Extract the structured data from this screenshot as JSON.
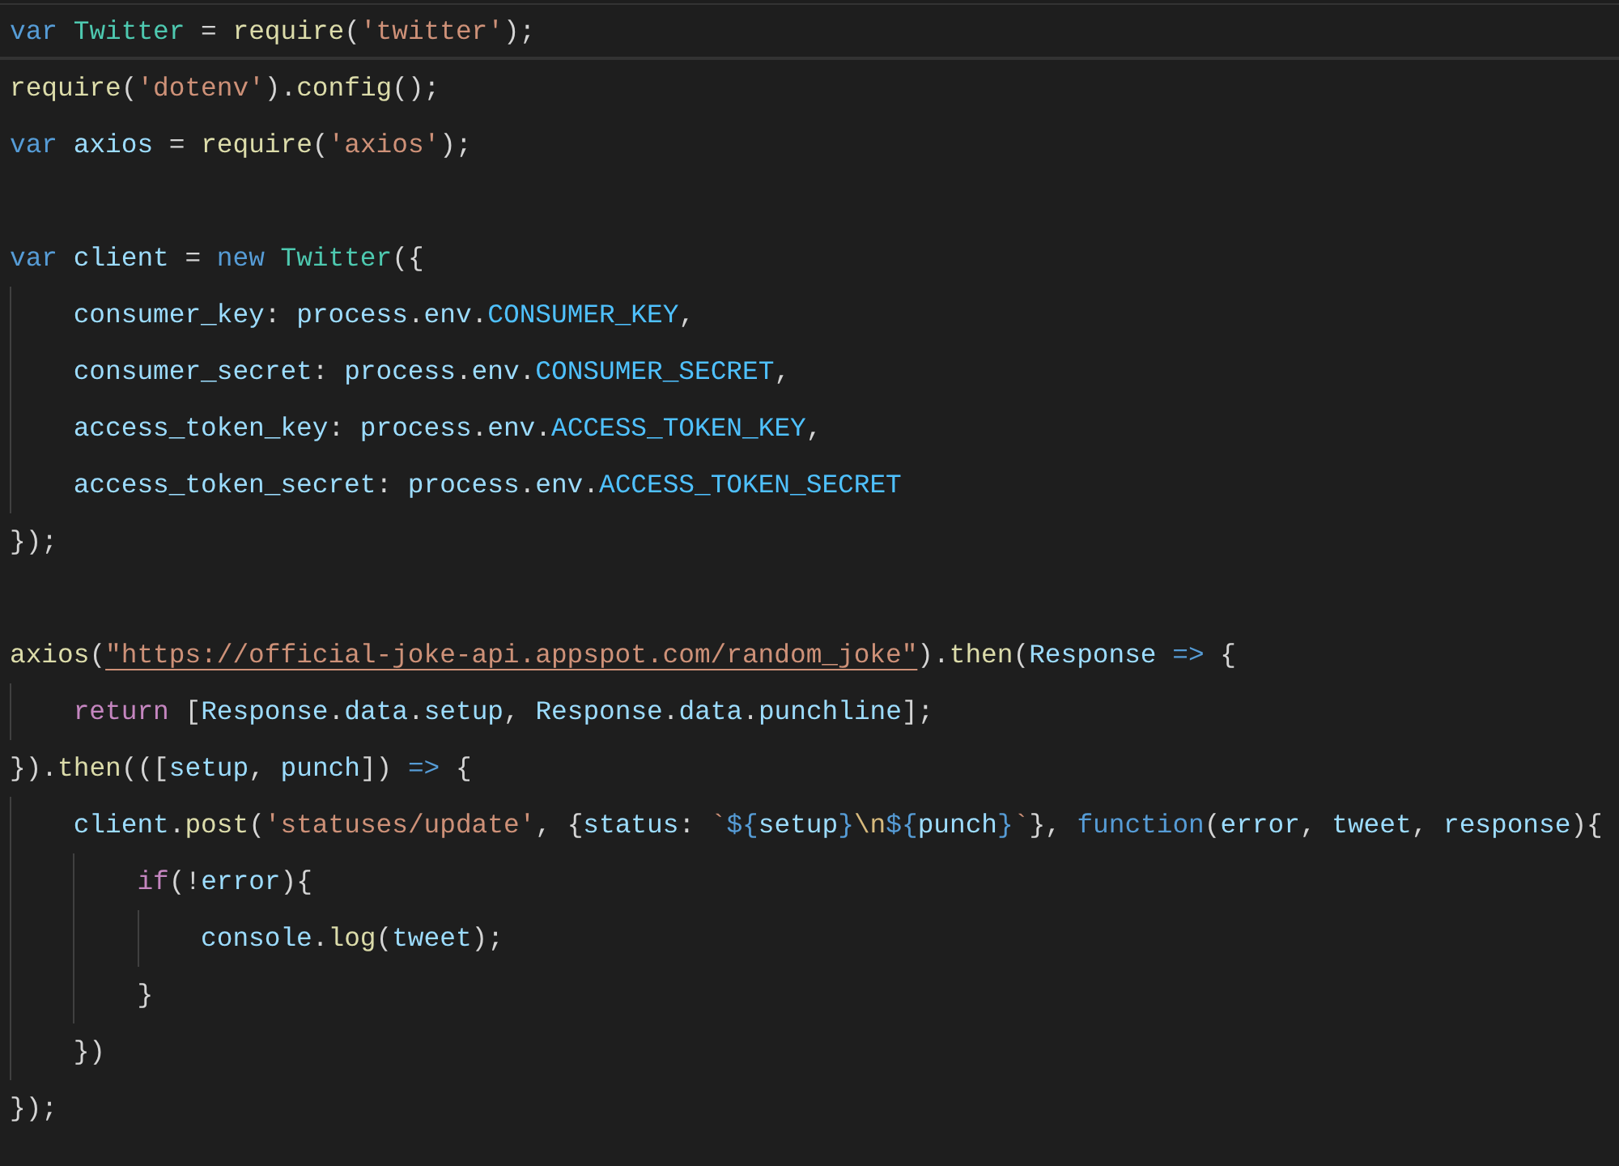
{
  "editor": {
    "lines": [
      {
        "kind": "code",
        "current": true,
        "tokens": [
          {
            "text": "var",
            "kind": "keyword"
          },
          {
            "text": " Twitter",
            "kind": "class"
          },
          {
            "text": " = ",
            "kind": "plain"
          },
          {
            "text": "require",
            "kind": "func"
          },
          {
            "text": "(",
            "kind": "plain"
          },
          {
            "text": "'twitter'",
            "kind": "string"
          },
          {
            "text": ");",
            "kind": "plain"
          }
        ]
      },
      {
        "kind": "code",
        "current": false,
        "tokens": [
          {
            "text": "require",
            "kind": "func"
          },
          {
            "text": "(",
            "kind": "plain"
          },
          {
            "text": "'dotenv'",
            "kind": "string"
          },
          {
            "text": ").",
            "kind": "plain"
          },
          {
            "text": "config",
            "kind": "func"
          },
          {
            "text": "();",
            "kind": "plain"
          }
        ]
      },
      {
        "kind": "code",
        "current": false,
        "tokens": [
          {
            "text": "var",
            "kind": "keyword"
          },
          {
            "text": " axios",
            "kind": "var"
          },
          {
            "text": " = ",
            "kind": "plain"
          },
          {
            "text": "require",
            "kind": "func"
          },
          {
            "text": "(",
            "kind": "plain"
          },
          {
            "text": "'axios'",
            "kind": "string"
          },
          {
            "text": ");",
            "kind": "plain"
          }
        ]
      },
      {
        "kind": "blank"
      },
      {
        "kind": "code",
        "current": false,
        "tokens": [
          {
            "text": "var",
            "kind": "keyword"
          },
          {
            "text": " client",
            "kind": "var"
          },
          {
            "text": " = ",
            "kind": "plain"
          },
          {
            "text": "new",
            "kind": "keyword"
          },
          {
            "text": " Twitter",
            "kind": "class"
          },
          {
            "text": "({",
            "kind": "plain"
          }
        ]
      },
      {
        "kind": "code",
        "current": false,
        "tokens": [
          {
            "text": "    consumer_key",
            "kind": "var"
          },
          {
            "text": ": ",
            "kind": "plain"
          },
          {
            "text": "process",
            "kind": "var"
          },
          {
            "text": ".",
            "kind": "plain"
          },
          {
            "text": "env",
            "kind": "var"
          },
          {
            "text": ".",
            "kind": "plain"
          },
          {
            "text": "CONSUMER_KEY",
            "kind": "const"
          },
          {
            "text": ",",
            "kind": "plain"
          }
        ]
      },
      {
        "kind": "code",
        "current": false,
        "tokens": [
          {
            "text": "    consumer_secret",
            "kind": "var"
          },
          {
            "text": ": ",
            "kind": "plain"
          },
          {
            "text": "process",
            "kind": "var"
          },
          {
            "text": ".",
            "kind": "plain"
          },
          {
            "text": "env",
            "kind": "var"
          },
          {
            "text": ".",
            "kind": "plain"
          },
          {
            "text": "CONSUMER_SECRET",
            "kind": "const"
          },
          {
            "text": ",",
            "kind": "plain"
          }
        ]
      },
      {
        "kind": "code",
        "current": false,
        "tokens": [
          {
            "text": "    access_token_key",
            "kind": "var"
          },
          {
            "text": ": ",
            "kind": "plain"
          },
          {
            "text": "process",
            "kind": "var"
          },
          {
            "text": ".",
            "kind": "plain"
          },
          {
            "text": "env",
            "kind": "var"
          },
          {
            "text": ".",
            "kind": "plain"
          },
          {
            "text": "ACCESS_TOKEN_KEY",
            "kind": "const"
          },
          {
            "text": ",",
            "kind": "plain"
          }
        ]
      },
      {
        "kind": "code",
        "current": false,
        "tokens": [
          {
            "text": "    access_token_secret",
            "kind": "var"
          },
          {
            "text": ": ",
            "kind": "plain"
          },
          {
            "text": "process",
            "kind": "var"
          },
          {
            "text": ".",
            "kind": "plain"
          },
          {
            "text": "env",
            "kind": "var"
          },
          {
            "text": ".",
            "kind": "plain"
          },
          {
            "text": "ACCESS_TOKEN_SECRET",
            "kind": "const"
          }
        ]
      },
      {
        "kind": "code",
        "current": false,
        "tokens": [
          {
            "text": "});",
            "kind": "plain"
          }
        ]
      },
      {
        "kind": "blank"
      },
      {
        "kind": "code",
        "current": false,
        "tokens": [
          {
            "text": "axios",
            "kind": "func"
          },
          {
            "text": "(",
            "kind": "plain"
          },
          {
            "text": "\"https://official-joke-api.appspot.com/random_joke\"",
            "kind": "link"
          },
          {
            "text": ").",
            "kind": "plain"
          },
          {
            "text": "then",
            "kind": "func"
          },
          {
            "text": "(",
            "kind": "plain"
          },
          {
            "text": "Response",
            "kind": "var"
          },
          {
            "text": " =>",
            "kind": "keyword"
          },
          {
            "text": " {",
            "kind": "plain"
          }
        ]
      },
      {
        "kind": "code",
        "current": false,
        "tokens": [
          {
            "text": "    return",
            "kind": "control"
          },
          {
            "text": " [",
            "kind": "plain"
          },
          {
            "text": "Response",
            "kind": "var"
          },
          {
            "text": ".",
            "kind": "plain"
          },
          {
            "text": "data",
            "kind": "var"
          },
          {
            "text": ".",
            "kind": "plain"
          },
          {
            "text": "setup",
            "kind": "var"
          },
          {
            "text": ", ",
            "kind": "plain"
          },
          {
            "text": "Response",
            "kind": "var"
          },
          {
            "text": ".",
            "kind": "plain"
          },
          {
            "text": "data",
            "kind": "var"
          },
          {
            "text": ".",
            "kind": "plain"
          },
          {
            "text": "punchline",
            "kind": "var"
          },
          {
            "text": "];",
            "kind": "plain"
          }
        ]
      },
      {
        "kind": "code",
        "current": false,
        "tokens": [
          {
            "text": "}).",
            "kind": "plain"
          },
          {
            "text": "then",
            "kind": "func"
          },
          {
            "text": "(([",
            "kind": "plain"
          },
          {
            "text": "setup",
            "kind": "var"
          },
          {
            "text": ", ",
            "kind": "plain"
          },
          {
            "text": "punch",
            "kind": "var"
          },
          {
            "text": "]) ",
            "kind": "plain"
          },
          {
            "text": "=>",
            "kind": "keyword"
          },
          {
            "text": " {",
            "kind": "plain"
          }
        ]
      },
      {
        "kind": "code",
        "current": false,
        "tokens": [
          {
            "text": "    client",
            "kind": "var"
          },
          {
            "text": ".",
            "kind": "plain"
          },
          {
            "text": "post",
            "kind": "func"
          },
          {
            "text": "(",
            "kind": "plain"
          },
          {
            "text": "'statuses/update'",
            "kind": "string"
          },
          {
            "text": ", {",
            "kind": "plain"
          },
          {
            "text": "status",
            "kind": "var"
          },
          {
            "text": ": ",
            "kind": "plain"
          },
          {
            "text": "`",
            "kind": "string"
          },
          {
            "text": "${",
            "kind": "keyword"
          },
          {
            "text": "setup",
            "kind": "var"
          },
          {
            "text": "}",
            "kind": "keyword"
          },
          {
            "text": "\\n",
            "kind": "escape"
          },
          {
            "text": "${",
            "kind": "keyword"
          },
          {
            "text": "punch",
            "kind": "var"
          },
          {
            "text": "}",
            "kind": "keyword"
          },
          {
            "text": "`",
            "kind": "string"
          },
          {
            "text": "}, ",
            "kind": "plain"
          },
          {
            "text": "function",
            "kind": "keyword"
          },
          {
            "text": "(",
            "kind": "plain"
          },
          {
            "text": "error",
            "kind": "var"
          },
          {
            "text": ", ",
            "kind": "plain"
          },
          {
            "text": "tweet",
            "kind": "var"
          },
          {
            "text": ", ",
            "kind": "plain"
          },
          {
            "text": "response",
            "kind": "var"
          },
          {
            "text": "){",
            "kind": "plain"
          }
        ]
      },
      {
        "kind": "code",
        "current": false,
        "tokens": [
          {
            "text": "        if",
            "kind": "control"
          },
          {
            "text": "(!",
            "kind": "plain"
          },
          {
            "text": "error",
            "kind": "var"
          },
          {
            "text": "){",
            "kind": "plain"
          }
        ]
      },
      {
        "kind": "code",
        "current": false,
        "tokens": [
          {
            "text": "            console",
            "kind": "var"
          },
          {
            "text": ".",
            "kind": "plain"
          },
          {
            "text": "log",
            "kind": "func"
          },
          {
            "text": "(",
            "kind": "plain"
          },
          {
            "text": "tweet",
            "kind": "var"
          },
          {
            "text": ");",
            "kind": "plain"
          }
        ]
      },
      {
        "kind": "code",
        "current": false,
        "tokens": [
          {
            "text": "        }",
            "kind": "plain"
          }
        ]
      },
      {
        "kind": "code",
        "current": false,
        "tokens": [
          {
            "text": "    })",
            "kind": "plain"
          }
        ]
      },
      {
        "kind": "code",
        "current": false,
        "tokens": [
          {
            "text": "});",
            "kind": "plain"
          }
        ]
      }
    ]
  }
}
